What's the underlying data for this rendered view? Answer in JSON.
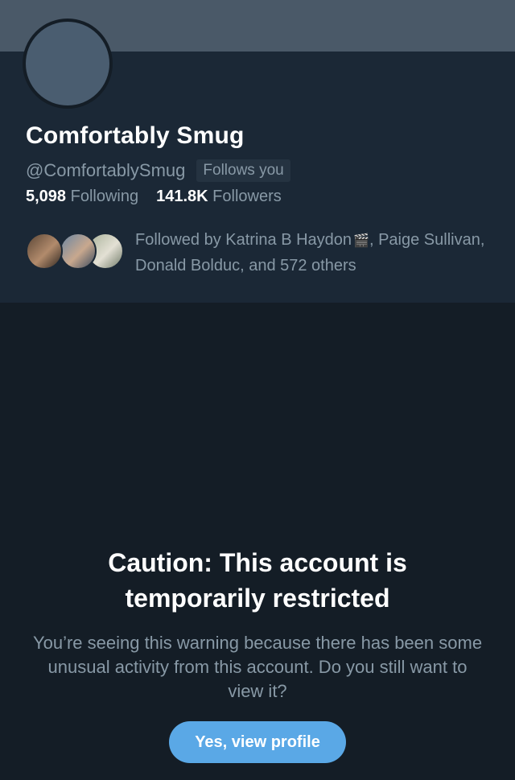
{
  "profile": {
    "display_name": "Comfortably Smug",
    "handle": "@ComfortablySmug",
    "follows_you_badge": "Follows you",
    "following_count": "5,098",
    "following_label": "Following",
    "followers_count": "141.8K",
    "followers_label": "Followers",
    "followed_by": {
      "prefix": "Followed by Katrina B Haydon",
      "icon": "clapper-board-icon",
      "suffix": ", Paige Sullivan, Donald Bolduc, and 572 others"
    }
  },
  "warning": {
    "title_line1": "Caution: This account is",
    "title_line2": "temporarily restricted",
    "body": "You’re seeing this warning because there has been some unusual activity from this account. Do you still want to view it?",
    "button_label": "Yes, view profile"
  },
  "colors": {
    "background": "#141d26",
    "panel": "#1b2836",
    "banner": "#4a5968",
    "secondary_text": "#8899a6",
    "accent_button": "#5aa8e6"
  }
}
